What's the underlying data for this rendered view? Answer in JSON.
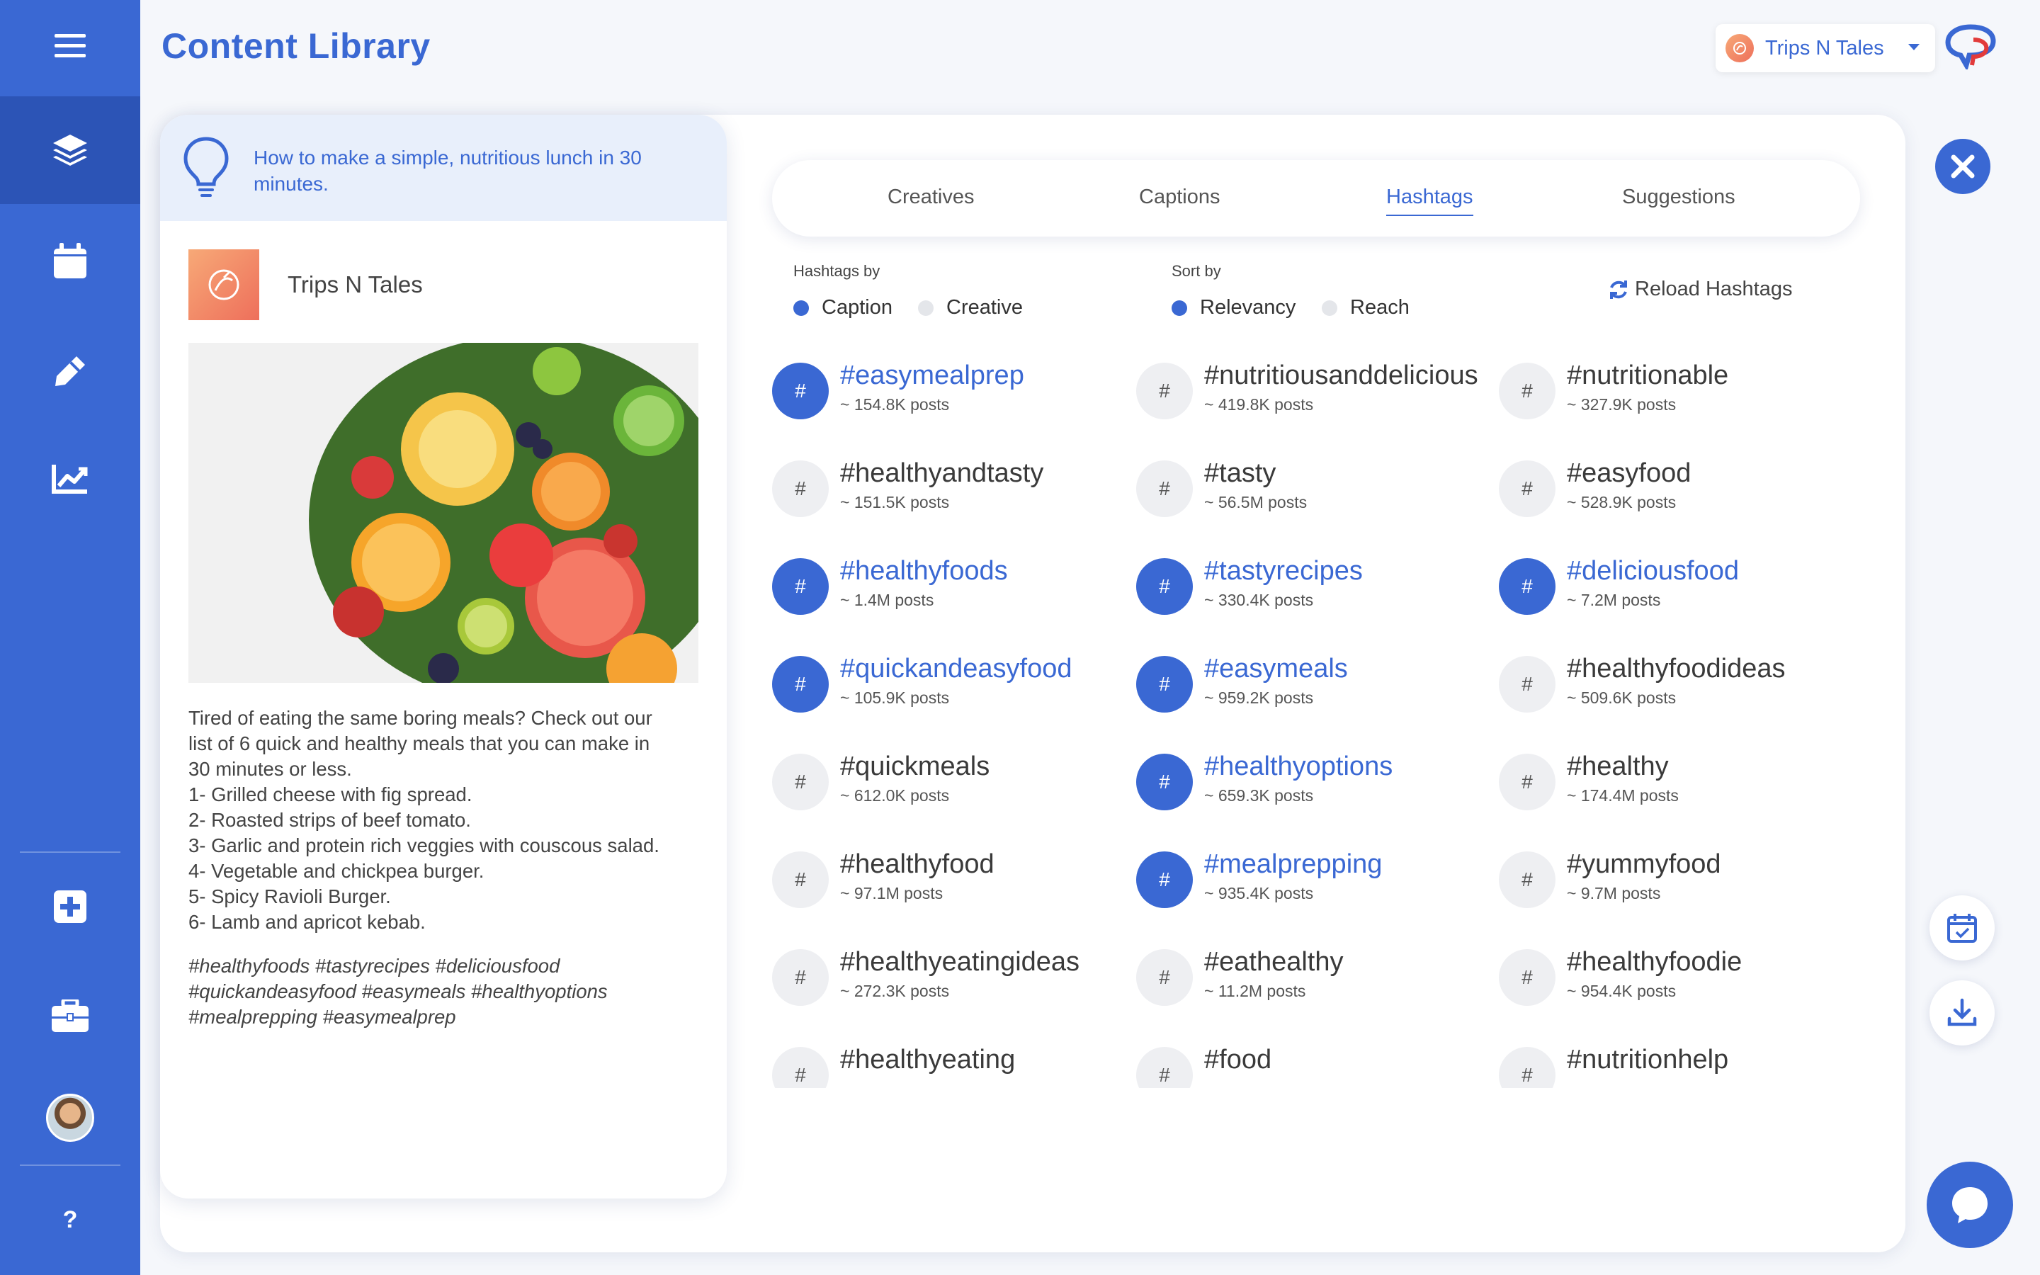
{
  "page": {
    "title": "Content Library"
  },
  "account": {
    "name": "Trips N Tales"
  },
  "sidebar": {
    "items": [
      {
        "icon": "menu-icon"
      },
      {
        "icon": "layers-icon",
        "active": true
      },
      {
        "icon": "calendar-icon"
      },
      {
        "icon": "pencil-icon"
      },
      {
        "icon": "analytics-icon"
      },
      {
        "icon": "add-icon"
      },
      {
        "icon": "briefcase-icon"
      },
      {
        "icon": "user-avatar"
      }
    ],
    "help_label": "?"
  },
  "preview": {
    "idea": "How to make a simple, nutritious lunch in 30 minutes.",
    "author": "Trips N Tales",
    "caption_lines": [
      "Tired of eating the same boring meals? Check out our",
      "list of 6 quick and healthy meals that you can make in",
      "30 minutes or less.",
      "1- Grilled cheese with fig spread.",
      "2- Roasted strips of beef tomato.",
      "3- Garlic and protein rich veggies with couscous salad.",
      "4- Vegetable and chickpea burger.",
      "5- Spicy Ravioli Burger.",
      "6- Lamb and apricot kebab."
    ],
    "caption_tag_lines": [
      "#healthyfoods #tastyrecipes #deliciousfood",
      "#quickandeasyfood #easymeals #healthyoptions",
      "#mealprepping #easymealprep"
    ]
  },
  "tabs": [
    {
      "label": "Creatives",
      "active": false
    },
    {
      "label": "Captions",
      "active": false
    },
    {
      "label": "Hashtags",
      "active": true
    },
    {
      "label": "Suggestions",
      "active": false
    }
  ],
  "filters": {
    "hashtags_by": {
      "label": "Hashtags by",
      "options": [
        "Caption",
        "Creative"
      ],
      "selected": "Caption"
    },
    "sort_by": {
      "label": "Sort by",
      "options": [
        "Relevancy",
        "Reach"
      ],
      "selected": "Relevancy"
    },
    "reload_label": "Reload Hashtags"
  },
  "hash_symbol": "#",
  "hashtags": [
    {
      "tag": "#easymealprep",
      "posts": "~ 154.8K posts",
      "selected": true
    },
    {
      "tag": "#nutritiousanddelicious",
      "posts": "~ 419.8K posts",
      "selected": false
    },
    {
      "tag": "#nutritionable",
      "posts": "~ 327.9K posts",
      "selected": false
    },
    {
      "tag": "#healthyandtasty",
      "posts": "~ 151.5K posts",
      "selected": false
    },
    {
      "tag": "#tasty",
      "posts": "~ 56.5M posts",
      "selected": false
    },
    {
      "tag": "#easyfood",
      "posts": "~ 528.9K posts",
      "selected": false
    },
    {
      "tag": "#healthyfoods",
      "posts": "~ 1.4M posts",
      "selected": true
    },
    {
      "tag": "#tastyrecipes",
      "posts": "~ 330.4K posts",
      "selected": true
    },
    {
      "tag": "#deliciousfood",
      "posts": "~ 7.2M posts",
      "selected": true
    },
    {
      "tag": "#quickandeasyfood",
      "posts": "~ 105.9K posts",
      "selected": true
    },
    {
      "tag": "#easymeals",
      "posts": "~ 959.2K posts",
      "selected": true
    },
    {
      "tag": "#healthyfoodideas",
      "posts": "~ 509.6K posts",
      "selected": false
    },
    {
      "tag": "#quickmeals",
      "posts": "~ 612.0K posts",
      "selected": false
    },
    {
      "tag": "#healthyoptions",
      "posts": "~ 659.3K posts",
      "selected": true
    },
    {
      "tag": "#healthy",
      "posts": "~ 174.4M posts",
      "selected": false
    },
    {
      "tag": "#healthyfood",
      "posts": "~ 97.1M posts",
      "selected": false
    },
    {
      "tag": "#mealprepping",
      "posts": "~ 935.4K posts",
      "selected": true
    },
    {
      "tag": "#yummyfood",
      "posts": "~ 9.7M posts",
      "selected": false
    },
    {
      "tag": "#healthyeatingideas",
      "posts": "~ 272.3K posts",
      "selected": false
    },
    {
      "tag": "#eathealthy",
      "posts": "~ 11.2M posts",
      "selected": false
    },
    {
      "tag": "#healthyfoodie",
      "posts": "~ 954.4K posts",
      "selected": false
    },
    {
      "tag": "#healthyeating",
      "posts": "",
      "selected": false
    },
    {
      "tag": "#food",
      "posts": "",
      "selected": false
    },
    {
      "tag": "#nutritionhelp",
      "posts": "",
      "selected": false
    }
  ],
  "colors": {
    "accent": "#3a68d3",
    "sidebar": "#3a68d3",
    "sidebar_active": "#2c54b6",
    "idea_bg": "#e8effb"
  }
}
